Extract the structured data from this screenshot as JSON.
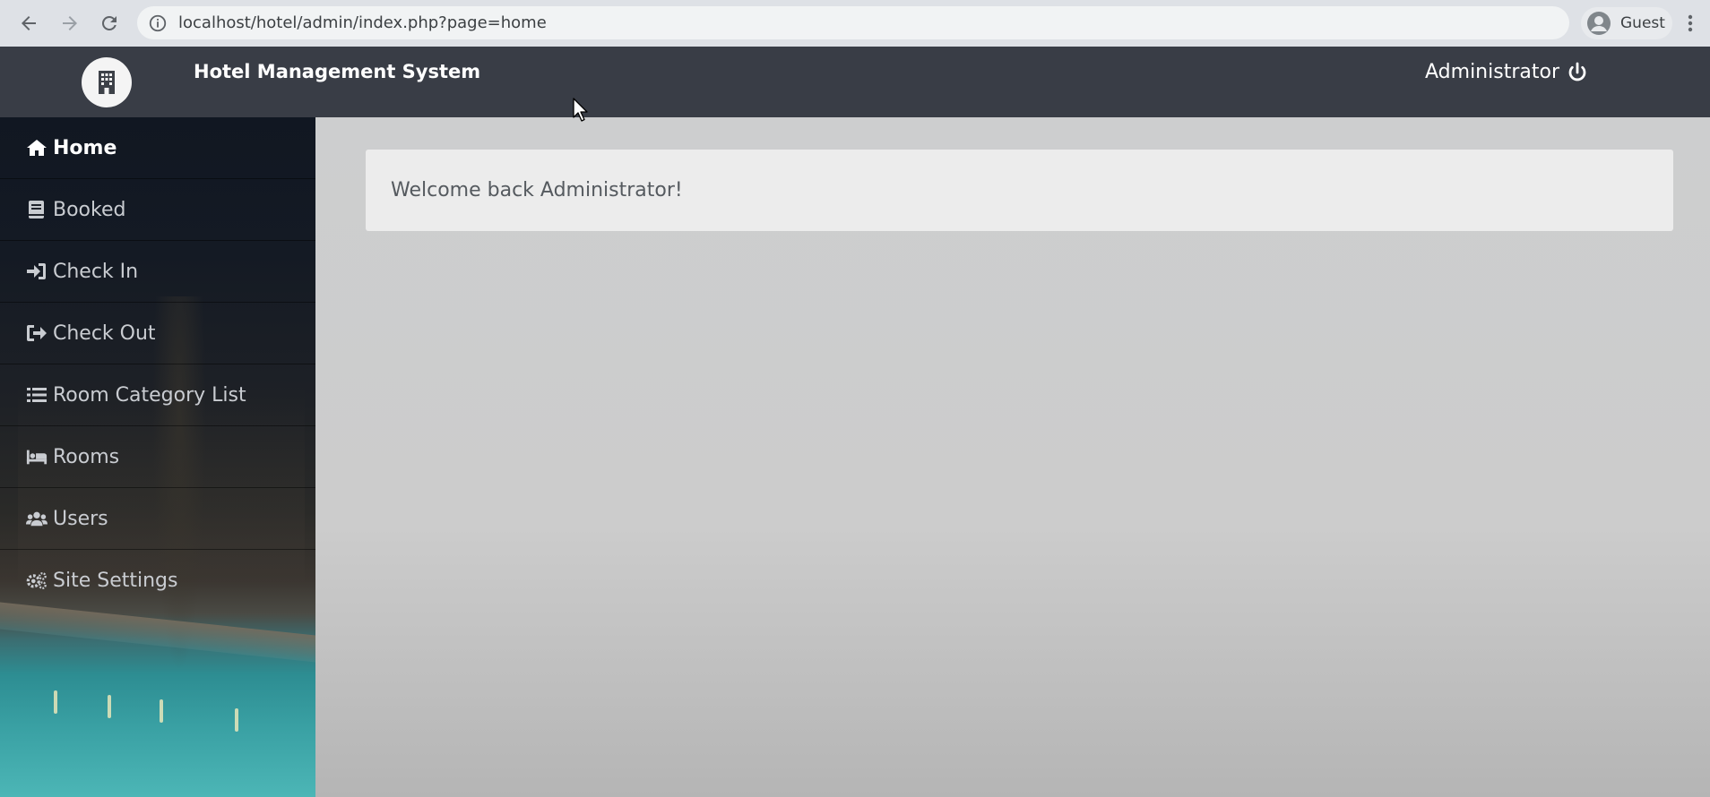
{
  "browser": {
    "url": "localhost/hotel/admin/index.php?page=home",
    "profile_label": "Guest",
    "back_icon": "arrow-left-icon",
    "forward_icon": "arrow-right-icon",
    "reload_icon": "reload-icon",
    "info_icon": "info-icon",
    "menu_icon": "kebab-menu-icon"
  },
  "header": {
    "title": "Hotel Management System",
    "user": "Administrator",
    "logo_icon": "building-icon",
    "logout_icon": "power-icon",
    "background": "#393d46"
  },
  "sidebar": {
    "items": [
      {
        "label": "Home",
        "icon": "home-icon",
        "active": true
      },
      {
        "label": "Booked",
        "icon": "book-icon",
        "active": false
      },
      {
        "label": "Check In",
        "icon": "sign-in-icon",
        "active": false
      },
      {
        "label": "Check Out",
        "icon": "sign-out-icon",
        "active": false
      },
      {
        "label": "Room Category List",
        "icon": "list-icon",
        "active": false
      },
      {
        "label": "Rooms",
        "icon": "bed-icon",
        "active": false
      },
      {
        "label": "Users",
        "icon": "users-icon",
        "active": false
      },
      {
        "label": "Site Settings",
        "icon": "cogs-icon",
        "active": false
      }
    ]
  },
  "main": {
    "welcome": "Welcome back Administrator!"
  }
}
